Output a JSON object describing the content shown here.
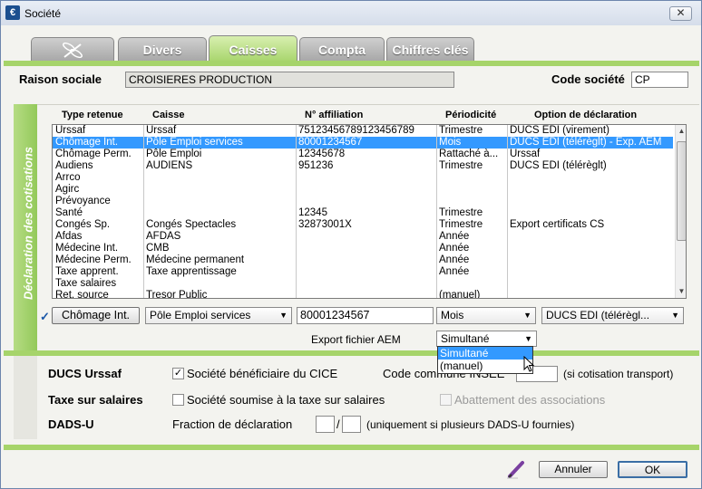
{
  "window": {
    "title": "Société",
    "app_icon": "€"
  },
  "tabs": [
    {
      "label": "",
      "icon": "dragonfly-icon"
    },
    {
      "label": "Divers"
    },
    {
      "label": "Caisses"
    },
    {
      "label": "Compta"
    },
    {
      "label": "Chiffres clés"
    }
  ],
  "active_tab": "Caisses",
  "header": {
    "raison_sociale_label": "Raison sociale",
    "raison_sociale_value": "CROISIERES PRODUCTION",
    "code_societe_label": "Code société",
    "code_societe_value": "CP"
  },
  "cotisations": {
    "section_label": "Déclaration des cotisations",
    "columns": [
      "Type retenue",
      "Caisse",
      "N° affiliation",
      "Périodicité",
      "Option de déclaration"
    ],
    "rows": [
      [
        "Urssaf",
        "Urssaf",
        "75123456789123456789",
        "Trimestre",
        "DUCS EDI (virement)"
      ],
      [
        "Chômage Int.",
        "Pôle Emploi services",
        "80001234567",
        "Mois",
        "DUCS EDI (télérèglt) - Exp. AEM"
      ],
      [
        "Chômage Perm.",
        "Pôle Emploi",
        "12345678",
        "Rattaché à...",
        "Urssaf"
      ],
      [
        "Audiens",
        "AUDIENS",
        "951236",
        "Trimestre",
        "DUCS EDI (télérèglt)"
      ],
      [
        "Arrco",
        "",
        "",
        "",
        ""
      ],
      [
        "Agirc",
        "",
        "",
        "",
        ""
      ],
      [
        "Prévoyance",
        "",
        "",
        "",
        ""
      ],
      [
        "Santé",
        "",
        "12345",
        "Trimestre",
        ""
      ],
      [
        "Congés Sp.",
        "Congés Spectacles",
        "32873001X",
        "Trimestre",
        "Export certificats CS"
      ],
      [
        "Afdas",
        "AFDAS",
        "",
        "Année",
        ""
      ],
      [
        "Médecine Int.",
        "CMB",
        "",
        "Année",
        ""
      ],
      [
        "Médecine Perm.",
        "Médecine permanent",
        "",
        "Année",
        ""
      ],
      [
        "Taxe apprent.",
        "Taxe apprentissage",
        "",
        "Année",
        ""
      ],
      [
        "Taxe salaires",
        "",
        "",
        "",
        ""
      ],
      [
        "Ret. source",
        "Tresor Public",
        "",
        "(manuel)",
        ""
      ]
    ],
    "selected_row": 1,
    "editor": {
      "check_mark": "✓",
      "type_button": "Chômage Int.",
      "caisse": "Pôle Emploi services",
      "affiliation": "80001234567",
      "periodicite": "Mois",
      "option": "DUCS EDI (télérègl..."
    },
    "export_aem_label": "Export fichier AEM",
    "export_aem_value": "Simultané",
    "export_aem_options": [
      "Simultané",
      "(manuel)"
    ],
    "export_aem_highlighted": "Simultané"
  },
  "bottom_section": {
    "ducs_label": "DUCS Urssaf",
    "cice_label": "Société bénéficiaire du CICE",
    "cice_checked": "✓",
    "code_commune_label": "Code commune INSEE",
    "code_commune_value": "",
    "transport_note": "(si cotisation transport)",
    "taxe_label": "Taxe sur salaires",
    "taxe_check_label": "Société soumise à la taxe sur salaires",
    "abattement_label": "Abattement des associations",
    "dadsu_label": "DADS-U",
    "fraction_label": "Fraction de déclaration",
    "fraction_num": "",
    "fraction_sep": "/",
    "fraction_den": "",
    "fraction_note": "(uniquement si plusieurs DADS-U fournies)"
  },
  "footer": {
    "cancel_label": "Annuler",
    "ok_label": "OK"
  }
}
